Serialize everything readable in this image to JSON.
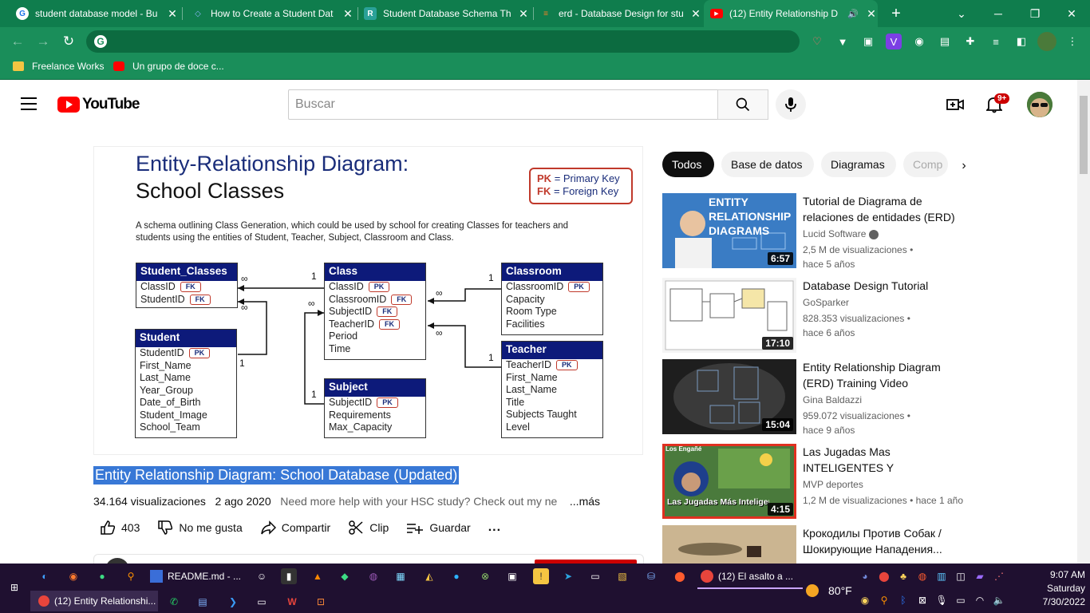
{
  "browser": {
    "tabs": [
      {
        "label": "student database model - Bu",
        "fav_color": "#1a73e8",
        "fav_glyph": "G"
      },
      {
        "label": "How to Create a Student Dat",
        "fav_color": "#4285f4",
        "fav_glyph": "◇"
      },
      {
        "label": "Student Database Schema Th",
        "fav_color": "#2aa198",
        "fav_glyph": "R"
      },
      {
        "label": "erd - Database Design for stu",
        "fav_color": "#f48024",
        "fav_glyph": "≡"
      },
      {
        "label": "(12) Entity Relationship D",
        "fav_color": "#ff0000",
        "fav_glyph": "▶"
      }
    ],
    "new_tab": "+",
    "address": "",
    "bookmarks": [
      {
        "label": "Freelance Works",
        "color": "#f4c542"
      },
      {
        "label": "Un grupo de doce c...",
        "color": "#ff0000"
      }
    ]
  },
  "youtube": {
    "logo": "YouTube",
    "search_placeholder": "Buscar",
    "notification_count": "9+"
  },
  "video_slide": {
    "title_line1": "Entity-Relationship Diagram:",
    "title_line2": "School Classes",
    "legend_pk": "PK",
    "legend_pk_text": "= Primary Key",
    "legend_fk": "FK",
    "legend_fk_text": "= Foreign Key",
    "description": "A schema outlining Class Generation, which could be used by school for creating Classes for teachers and students using the entities of Student, Teacher, Subject, Classroom and Class.",
    "entities": {
      "student_classes": {
        "name": "Student_Classes",
        "fields": [
          [
            "ClassID",
            "FK"
          ],
          [
            "StudentID",
            "FK"
          ]
        ]
      },
      "class": {
        "name": "Class",
        "fields": [
          [
            "ClassID",
            "PK"
          ],
          [
            "ClassroomID",
            "FK"
          ],
          [
            "SubjectID",
            "FK"
          ],
          [
            "TeacherID",
            "FK"
          ],
          [
            "Period",
            ""
          ],
          [
            "Time",
            ""
          ]
        ]
      },
      "classroom": {
        "name": "Classroom",
        "fields": [
          [
            "ClassroomID",
            "PK"
          ],
          [
            "Capacity",
            ""
          ],
          [
            "Room Type",
            ""
          ],
          [
            "Facilities",
            ""
          ]
        ]
      },
      "student": {
        "name": "Student",
        "fields": [
          [
            "StudentID",
            "PK"
          ],
          [
            "First_Name",
            ""
          ],
          [
            "Last_Name",
            ""
          ],
          [
            "Year_Group",
            ""
          ],
          [
            "Date_of_Birth",
            ""
          ],
          [
            "Student_Image",
            ""
          ],
          [
            "School_Team",
            ""
          ]
        ]
      },
      "teacher": {
        "name": "Teacher",
        "fields": [
          [
            "TeacherID",
            "PK"
          ],
          [
            "First_Name",
            ""
          ],
          [
            "Last_Name",
            ""
          ],
          [
            "Title",
            ""
          ],
          [
            "Subjects Taught",
            ""
          ],
          [
            "Level",
            ""
          ]
        ]
      },
      "subject": {
        "name": "Subject",
        "fields": [
          [
            "SubjectID",
            "PK"
          ],
          [
            "Requirements",
            ""
          ],
          [
            "Max_Capacity",
            ""
          ]
        ]
      }
    },
    "cardinality": {
      "one": "1",
      "many": "∞"
    }
  },
  "video": {
    "title": "Entity Relationship Diagram: School Database (Updated)",
    "views": "34.164 visualizaciones",
    "date": "2 ago 2020",
    "description_preview": "Need more help with your HSC study? Check out my ne",
    "more": "...más",
    "likes": "403",
    "dislike": "No me gusta",
    "share": "Compartir",
    "clip": "Clip",
    "save": "Guardar",
    "more_actions": "..."
  },
  "chips": [
    {
      "label": "Todos",
      "active": true
    },
    {
      "label": "Base de datos",
      "active": false
    },
    {
      "label": "Diagramas",
      "active": false
    },
    {
      "label": "Comp",
      "active": false
    }
  ],
  "recommendations": [
    {
      "title": "Tutorial de Diagrama de relaciones de entidades (ERD)",
      "channel": "Lucid Software",
      "verified": true,
      "views": "2,5 M de visualizaciones",
      "age": "hace 5 años",
      "duration": "6:57",
      "thumb_bg": "#2b6fb3",
      "thumb_text": "ENTITY RELATIONSHIP DIAGRAMS"
    },
    {
      "title": "Database Design Tutorial",
      "channel": "GoSparker",
      "verified": false,
      "views": "828.353 visualizaciones",
      "age": "hace 6 años",
      "duration": "17:10",
      "thumb_bg": "#e8e8e8",
      "thumb_text": ""
    },
    {
      "title": "Entity Relationship Diagram (ERD) Training Video",
      "channel": "Gina Baldazzi",
      "verified": false,
      "views": "959.072 visualizaciones",
      "age": "hace 9 años",
      "duration": "15:04",
      "thumb_bg": "#2a2a2a",
      "thumb_text": ""
    },
    {
      "title": "Las Jugadas Mas INTELIGENTES Y CREATIVAS...",
      "channel": "MVP deportes",
      "verified": false,
      "views": "1,2 M de visualizaciones",
      "age": "hace 1 año",
      "duration": "4:15",
      "thumb_bg": "#3b6e2f",
      "thumb_text": "Las Jugadas Más Inteligentes Y Creativas En La MLB"
    },
    {
      "title": "Крокодилы Против Собак / Шокирующие Нападения...",
      "channel": "",
      "verified": false,
      "views": "",
      "age": "",
      "duration": "",
      "thumb_bg": "#c9b08a",
      "thumb_text": ""
    }
  ],
  "taskbar": {
    "readme": "README.md - ...",
    "chrome_window": "(12) El asalto a ...",
    "active_window": "(12) Entity Relationshi...",
    "weather": "80°F",
    "time": "9:07 AM",
    "day": "Saturday",
    "date": "7/30/2022"
  }
}
